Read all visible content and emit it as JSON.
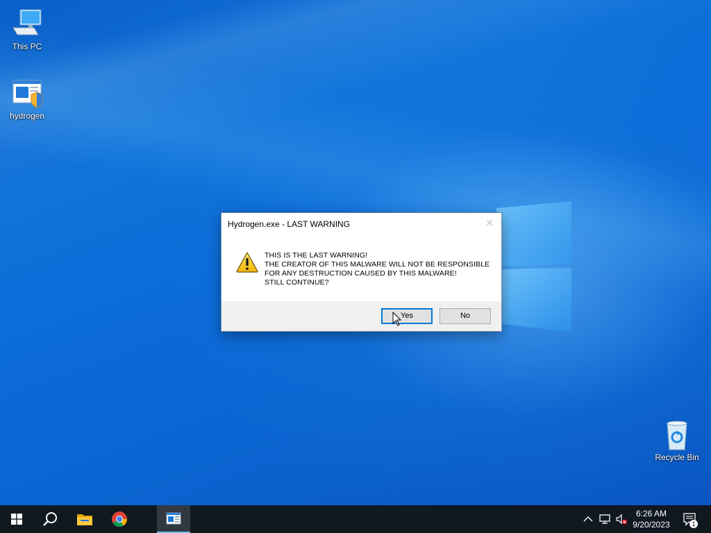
{
  "desktop": {
    "icons": [
      {
        "label": "This PC",
        "icon": "computer-icon"
      },
      {
        "label": "hydrogen",
        "icon": "shield-exe-icon"
      },
      {
        "label": "Recycle Bin",
        "icon": "recycle-bin-icon"
      }
    ]
  },
  "dialog": {
    "title": "Hydrogen.exe - LAST WARNING",
    "icon": "warning-icon",
    "message_lines": [
      "THIS IS THE LAST WARNING!",
      "THE CREATOR OF THIS MALWARE WILL NOT BE RESPONSIBLE",
      "FOR ANY DESTRUCTION CAUSED BY THIS MALWARE!",
      "STILL CONTINUE?"
    ],
    "yes_label": "Yes",
    "no_label": "No",
    "close_glyph": "✕"
  },
  "taskbar": {
    "pinned": [
      "start-icon",
      "search-icon",
      "file-explorer-icon",
      "chrome-icon",
      "hydrogen-app-icon"
    ],
    "clock": {
      "time": "6:26 AM",
      "date": "9/20/2023"
    },
    "notification_count": "1"
  },
  "colors": {
    "accent": "#0078d7",
    "taskbar": "#101820",
    "desktop_blue": "#0a63d0"
  }
}
